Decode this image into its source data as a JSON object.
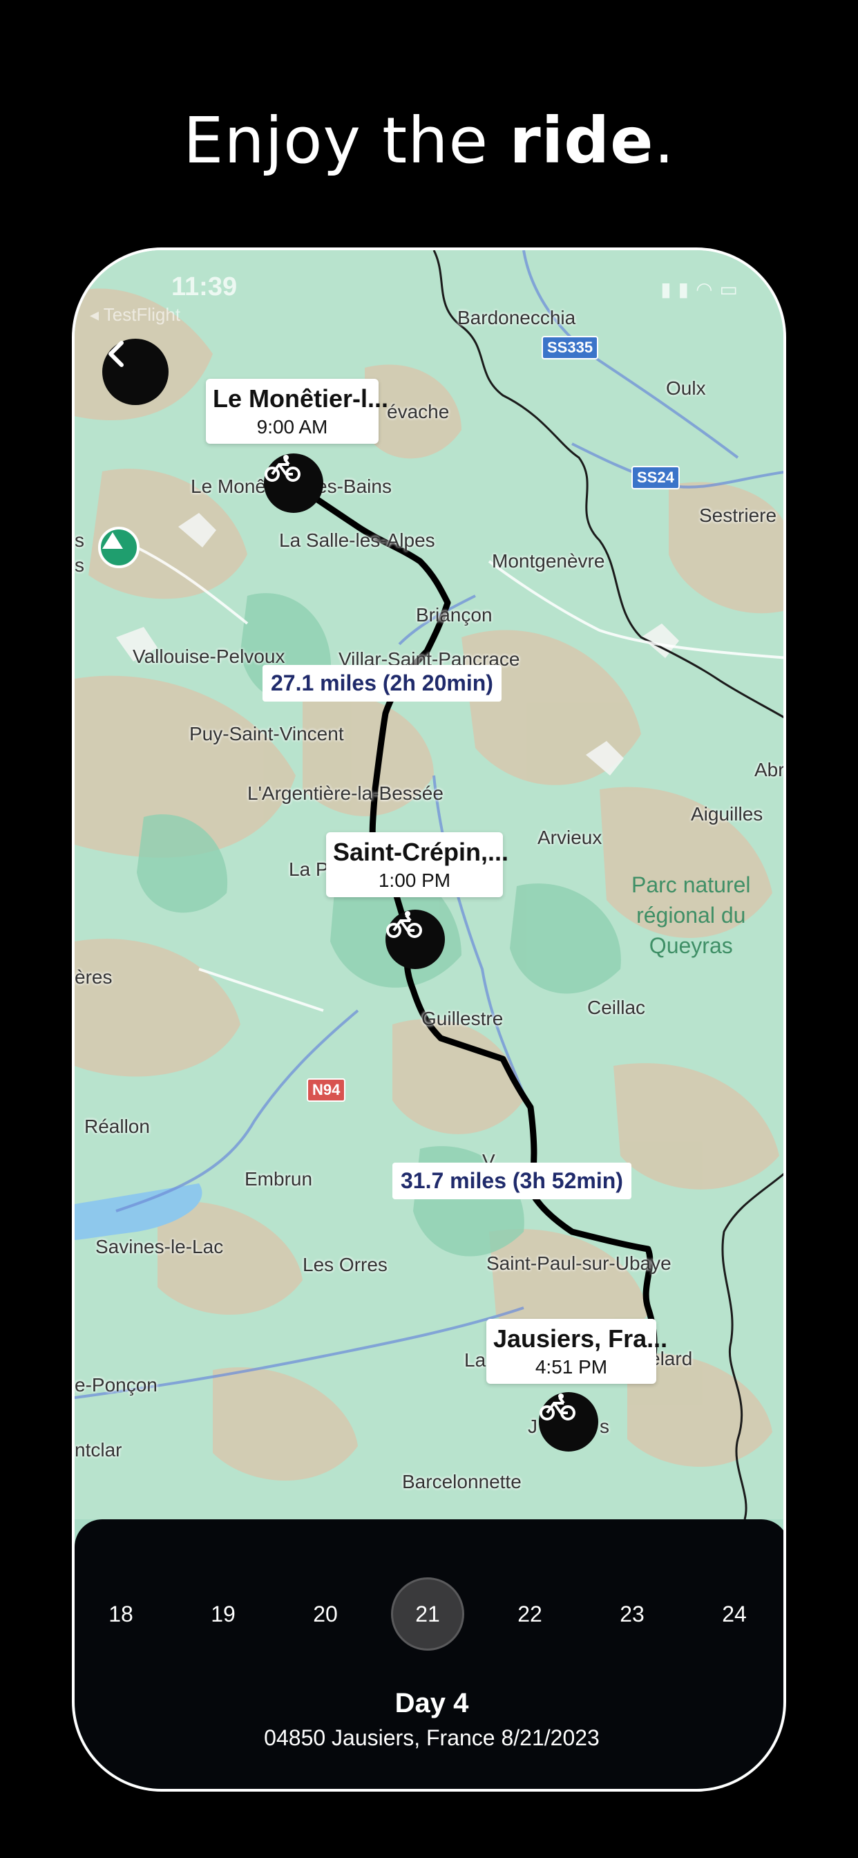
{
  "headline": {
    "prefix": "Enjoy the ",
    "bold": "ride",
    "suffix": "."
  },
  "status": {
    "time": "11:39",
    "app_back": "◂ TestFlight"
  },
  "towns": [
    "Bardonecchia",
    "Oulx",
    "Sestriere",
    "évache",
    "Le Monê",
    "es-Bains",
    "La Salle-les-Alpes",
    "Montgenèvre",
    "Briançon",
    "Vallouise-Pelvoux",
    "Villar-Saint-Pancrace",
    "Puy-Saint-Vincent",
    "L'Argentière-la-Bessée",
    "Abr",
    "Aiguilles",
    "Arvieux",
    "La P",
    "ères",
    "Ceillac",
    "Guillestre",
    "Réallon",
    "Embrun",
    "V",
    "Savines-le-Lac",
    "Les Orres",
    "Saint-Paul-sur-Ubaye",
    "La",
    "elard",
    "e-Ponçon",
    "ntclar",
    "Barcelonnette",
    "J",
    "s",
    "s",
    "s"
  ],
  "park": "Parc naturel\nrégional du\nQueyras",
  "roads": [
    "SS335",
    "SS24",
    "N94"
  ],
  "stops": [
    {
      "name": "Le Monêtier-l...",
      "time": "9:00 AM"
    },
    {
      "name": "Saint-Crépin,...",
      "time": "1:00 PM"
    },
    {
      "name": "Jausiers, Fra...",
      "time": "4:51 PM"
    }
  ],
  "segments": [
    {
      "label": "27.1 miles (2h 20min)"
    },
    {
      "label": "31.7 miles (3h 52min)"
    }
  ],
  "days": [
    "18",
    "19",
    "20",
    "21",
    "22",
    "23",
    "24"
  ],
  "selected_day": "21",
  "day_title": "Day 4",
  "day_subtitle": "04850 Jausiers, France 8/21/2023",
  "colors": {
    "route": "#000000",
    "map_green": "#a9dcc6",
    "label_text": "#1f2a6b",
    "panel": "#05070b"
  }
}
